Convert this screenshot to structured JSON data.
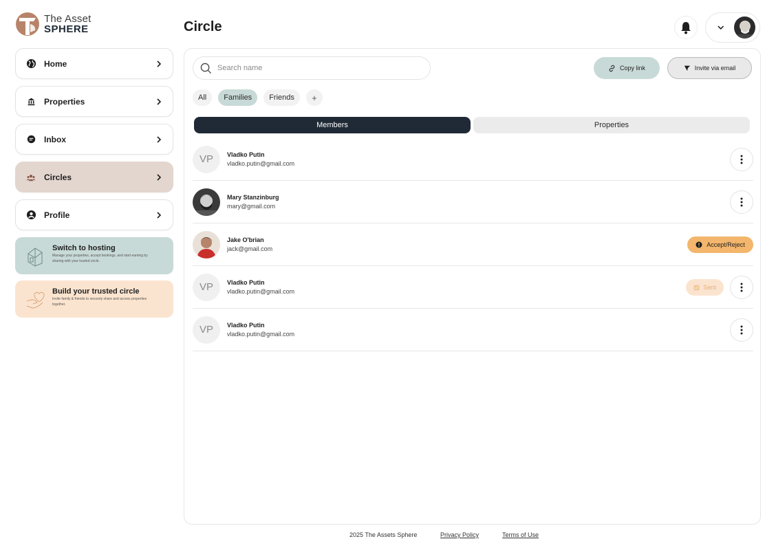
{
  "brand": {
    "line1": "The Asset",
    "line2": "SPHERE"
  },
  "sidebar": {
    "items": [
      {
        "label": "Home",
        "icon": "globe-icon"
      },
      {
        "label": "Properties",
        "icon": "bank-icon"
      },
      {
        "label": "Inbox",
        "icon": "chat-icon"
      },
      {
        "label": "Circles",
        "icon": "group-icon",
        "active": true
      },
      {
        "label": "Profile",
        "icon": "user-icon"
      }
    ],
    "promos": [
      {
        "title": "Switch to hosting",
        "desc": "Manage your properties, accept bookings, and start earning by sharing with your trusted circle.",
        "icon": "house-icon",
        "color": "#c8dad7"
      },
      {
        "title": "Build your trusted circle",
        "desc": "Invite family & friends to securely share and access properties together.",
        "icon": "heart-hand-icon",
        "color": "#fbe4cf"
      }
    ]
  },
  "header": {
    "title": "Circle"
  },
  "toolbar": {
    "search_placeholder": "Search name",
    "copy_link": "Copy link",
    "invite": "Invite via email"
  },
  "filters": {
    "all": "All",
    "families": "Families",
    "friends": "Friends",
    "add": "+"
  },
  "tabs": {
    "members": "Members",
    "properties": "Properties"
  },
  "members": [
    {
      "initials": "VP",
      "name": "Vladko Putin",
      "email": "vladko.putin@gmail.com"
    },
    {
      "initials": "",
      "name": "Mary Stanzinburg",
      "email": "mary@gmail.com"
    },
    {
      "initials": "",
      "name": "Jake O'brian",
      "email": "jack@gmail.com",
      "action": "Accept/Reject"
    },
    {
      "initials": "VP",
      "name": "Vladko Putin",
      "email": "vladko.putin@gmail.com",
      "status": "Sent"
    },
    {
      "initials": "VP",
      "name": "Vladko Putin",
      "email": "vladko.putin@gmail.com"
    }
  ],
  "footer": {
    "copyright": "2025 The Assets Sphere",
    "privacy": "Privacy Policy",
    "terms": "Terms of Use"
  },
  "colors": {
    "accent_teal": "#c8dad7",
    "accent_peach": "#fbe4cf",
    "navy": "#1f2a36",
    "orange": "#f3b66c",
    "active_nav": "#e2d6cf"
  }
}
